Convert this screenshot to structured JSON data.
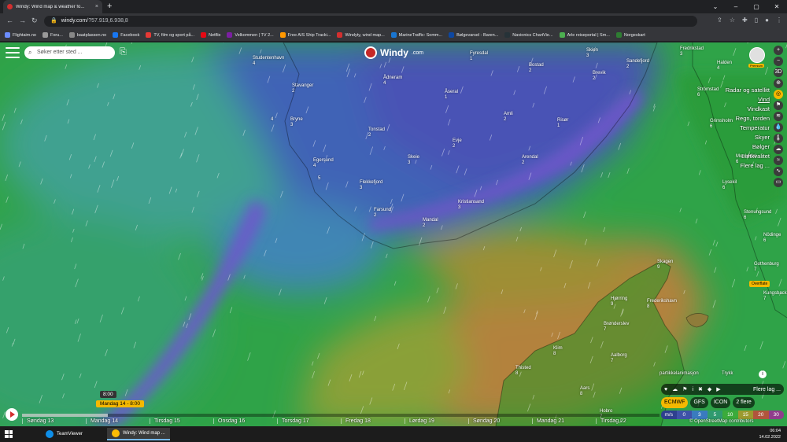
{
  "browser": {
    "tab_title": "Windy: Wind map & weather fo...",
    "tab_close": "×",
    "new_tab": "+",
    "win_controls": [
      "⌄",
      "–",
      "▢",
      "✕"
    ],
    "url_host": "windy.com",
    "url_path": "/?57.919,6.938,8",
    "bookmarks": [
      {
        "label": "Flightaim.no",
        "color": "#6b8cff"
      },
      {
        "label": "Foru...",
        "color": "#999999"
      },
      {
        "label": "baatplassen.no",
        "color": "#888888"
      },
      {
        "label": "Facebook",
        "color": "#1877f2"
      },
      {
        "label": "TV, film og sport på...",
        "color": "#e53935"
      },
      {
        "label": "Netflix",
        "color": "#e50914"
      },
      {
        "label": "Velkommen | TV 2...",
        "color": "#7b1fa2"
      },
      {
        "label": "Free AIS Ship Tracki...",
        "color": "#ff9800"
      },
      {
        "label": "Windyty, wind map...",
        "color": "#d32f2f"
      },
      {
        "label": "MarineTraffic: Somm...",
        "color": "#1976d2"
      },
      {
        "label": "Bølgevarsel - Baren...",
        "color": "#0d47a1"
      },
      {
        "label": "Navionics ChartVie...",
        "color": "#263238"
      },
      {
        "label": "Arle reiseportal | Sm...",
        "color": "#4caf50"
      },
      {
        "label": "Norgeskart",
        "color": "#2e7d32"
      }
    ]
  },
  "app": {
    "search_placeholder": "Søker etter sted ...",
    "logo_text": "Windy",
    "logo_suffix": ".com",
    "premium_label": "Premium",
    "right_buttons": [
      "+",
      "−",
      "3D",
      "⊕",
      "◎",
      "⚑",
      "≋",
      "💧",
      "🌡",
      "☁",
      "≈",
      "∿",
      "▭"
    ],
    "layers": [
      {
        "label": "Radar og satellitt",
        "selected": false
      },
      {
        "label": "Vind",
        "selected": true
      },
      {
        "label": "Vindkast",
        "selected": false
      },
      {
        "label": "Regn, torden",
        "selected": false
      },
      {
        "label": "Temperatur",
        "selected": false
      },
      {
        "label": "Skyer",
        "selected": false
      },
      {
        "label": "Bølger",
        "selected": false
      },
      {
        "label": "Luftkvalitet",
        "selected": false
      },
      {
        "label": "Flere lag ...",
        "selected": false
      }
    ],
    "overflow_badge": "Overflate",
    "pointer_label": "partikkelanimasjon",
    "pressure_label": "Trykk",
    "info_label": "i",
    "icon_row": [
      "♥",
      "☁",
      "⚑",
      "i",
      "✖",
      "◆",
      "▶"
    ],
    "icon_row_more": "Flere lag ...",
    "models": [
      {
        "label": "ECMWF",
        "selected": true
      },
      {
        "label": "GFS",
        "selected": false
      },
      {
        "label": "ICON",
        "selected": false
      },
      {
        "label": "2 flere",
        "selected": false
      }
    ],
    "new_badge": "NEW",
    "scale": [
      {
        "label": "m/s",
        "color": "#2e3f8f"
      },
      {
        "label": "0",
        "color": "#3e52a8"
      },
      {
        "label": "3",
        "color": "#3a7bbf"
      },
      {
        "label": "5",
        "color": "#2f9a6f"
      },
      {
        "label": "10",
        "color": "#3bab3b"
      },
      {
        "label": "15",
        "color": "#9c9a2f"
      },
      {
        "label": "20",
        "color": "#b0553c"
      },
      {
        "label": "30",
        "color": "#8f3d8c"
      }
    ],
    "timeline": {
      "days": [
        "Søndag 13",
        "Mandag 14",
        "Tirsdag 15",
        "Onsdag 16",
        "Torsdag 17",
        "Fredag 18",
        "Lørdag 19",
        "Søndag 20",
        "Mandag 21",
        "Tirsdag 22"
      ],
      "selected": "Mandag 14 - 8:00",
      "hour": "8:00",
      "progress": 0.135
    },
    "attribution": "© OpenStreetMap contributors"
  },
  "places": [
    {
      "name": "Studentenhavn",
      "wind": "4"
    },
    {
      "name": "Stavanger",
      "wind": "2"
    },
    {
      "name": "Bryne",
      "wind": "3"
    },
    {
      "name": "Egersund",
      "wind": "4"
    },
    {
      "name": "Flekkefjord",
      "wind": "3"
    },
    {
      "name": "Farsund",
      "wind": "2"
    },
    {
      "name": "Mandal",
      "wind": "2"
    },
    {
      "name": "Kristiansand",
      "wind": "3"
    },
    {
      "name": "Ådneram",
      "wind": "4"
    },
    {
      "name": "Åseral",
      "wind": "1"
    },
    {
      "name": "Tonstad",
      "wind": "2"
    },
    {
      "name": "Skeie",
      "wind": "3"
    },
    {
      "name": "Evje",
      "wind": "2"
    },
    {
      "name": "Amli",
      "wind": "2"
    },
    {
      "name": "Arendal",
      "wind": "2"
    },
    {
      "name": "Risør",
      "wind": "1"
    },
    {
      "name": "Fyresdal",
      "wind": "1"
    },
    {
      "name": "Bostad",
      "wind": "2"
    },
    {
      "name": "Skien",
      "wind": "3"
    },
    {
      "name": "Brevik",
      "wind": "2"
    },
    {
      "name": "Sandefjord",
      "wind": "2"
    },
    {
      "name": "Fredrikstad",
      "wind": "3"
    },
    {
      "name": "Halden",
      "wind": "4"
    },
    {
      "name": "Strömstad",
      "wind": "6"
    },
    {
      "name": "Grimsholm",
      "wind": "6"
    },
    {
      "name": "Munkedal",
      "wind": "6"
    },
    {
      "name": "Lysekil",
      "wind": "6"
    },
    {
      "name": "Stenungsund",
      "wind": "6"
    },
    {
      "name": "Nödinge",
      "wind": "6"
    },
    {
      "name": "Gothenburg",
      "wind": "7"
    },
    {
      "name": "Kungsbacka",
      "wind": "7"
    },
    {
      "name": "Skagen",
      "wind": "9"
    },
    {
      "name": "Hjørring",
      "wind": "9"
    },
    {
      "name": "Frederikshavn",
      "wind": "8"
    },
    {
      "name": "Brønderslev",
      "wind": "7"
    },
    {
      "name": "Klim",
      "wind": "8"
    },
    {
      "name": "Aalborg",
      "wind": "7"
    },
    {
      "name": "Thisted",
      "wind": "8"
    },
    {
      "name": "Aars",
      "wind": "8"
    },
    {
      "name": "Hobro",
      "wind": "7"
    },
    {
      "name": "",
      "wind": "4"
    },
    {
      "name": "",
      "wind": "5"
    }
  ],
  "taskbar": {
    "apps": [
      {
        "label": "TeamViewer",
        "color": "#0e8ee9",
        "active": false
      },
      {
        "label": "Windy: Wind map ...",
        "color": "#fbbc04",
        "active": true
      }
    ],
    "time": "06:04",
    "date": "14.02.2022"
  }
}
